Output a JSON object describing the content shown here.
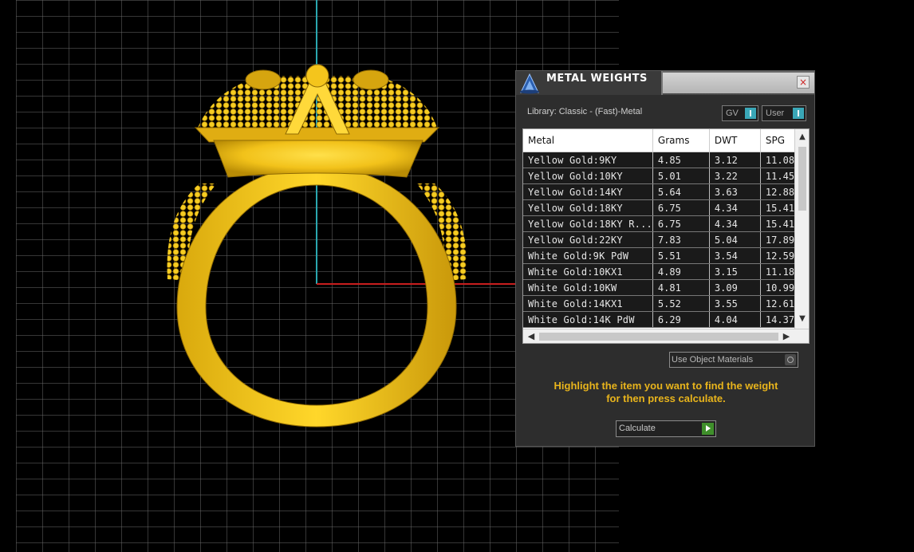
{
  "panel": {
    "title": "METAL WEIGHTS",
    "close_glyph": "×",
    "library_label": "Library: Classic - (Fast)-Metal",
    "toggle_gv_label": "GV",
    "toggle_user_label": "User",
    "use_object_materials_label": "Use Object Materials",
    "hint_line1": "Highlight the item you want to find the weight",
    "hint_line2": "for then press calculate.",
    "calculate_label": "Calculate",
    "icons": {
      "logo": "rhino-logo-icon",
      "close": "close-icon",
      "scroll_up": "chevron-up-icon",
      "scroll_down": "chevron-down-icon",
      "scroll_left": "chevron-left-icon",
      "scroll_right": "chevron-right-icon",
      "calculate": "play-icon"
    },
    "colors": {
      "accent": "#3aa7b7",
      "hint": "#e8b41c",
      "calculate_button": "#3f8f2b"
    }
  },
  "table": {
    "columns": [
      "Metal",
      "Grams",
      "DWT",
      "SPG"
    ],
    "rows": [
      {
        "metal": "Yellow Gold:9KY",
        "grams": "4.85",
        "dwt": "3.12",
        "spg": "11.08"
      },
      {
        "metal": "Yellow Gold:10KY",
        "grams": "5.01",
        "dwt": "3.22",
        "spg": "11.45"
      },
      {
        "metal": "Yellow Gold:14KY",
        "grams": "5.64",
        "dwt": "3.63",
        "spg": "12.88"
      },
      {
        "metal": "Yellow Gold:18KY",
        "grams": "6.75",
        "dwt": "4.34",
        "spg": "15.41"
      },
      {
        "metal": "Yellow Gold:18KY R...",
        "grams": "6.75",
        "dwt": "4.34",
        "spg": "15.41"
      },
      {
        "metal": "Yellow Gold:22KY",
        "grams": "7.83",
        "dwt": "5.04",
        "spg": "17.89"
      },
      {
        "metal": "White Gold:9K PdW",
        "grams": "5.51",
        "dwt": "3.54",
        "spg": "12.59"
      },
      {
        "metal": "White Gold:10KX1",
        "grams": "4.89",
        "dwt": "3.15",
        "spg": "11.18"
      },
      {
        "metal": "White Gold:10KW",
        "grams": "4.81",
        "dwt": "3.09",
        "spg": "10.99"
      },
      {
        "metal": "White Gold:14KX1",
        "grams": "5.52",
        "dwt": "3.55",
        "spg": "12.61"
      },
      {
        "metal": "White Gold:14K PdW",
        "grams": "6.29",
        "dwt": "4.04",
        "spg": "14.37"
      }
    ]
  },
  "viewport": {
    "grid_color": "#6b6b6b",
    "axis_y_color": "#2aa7b0",
    "axis_x_color": "#c81e1e",
    "model_color": "#f2c21a"
  }
}
